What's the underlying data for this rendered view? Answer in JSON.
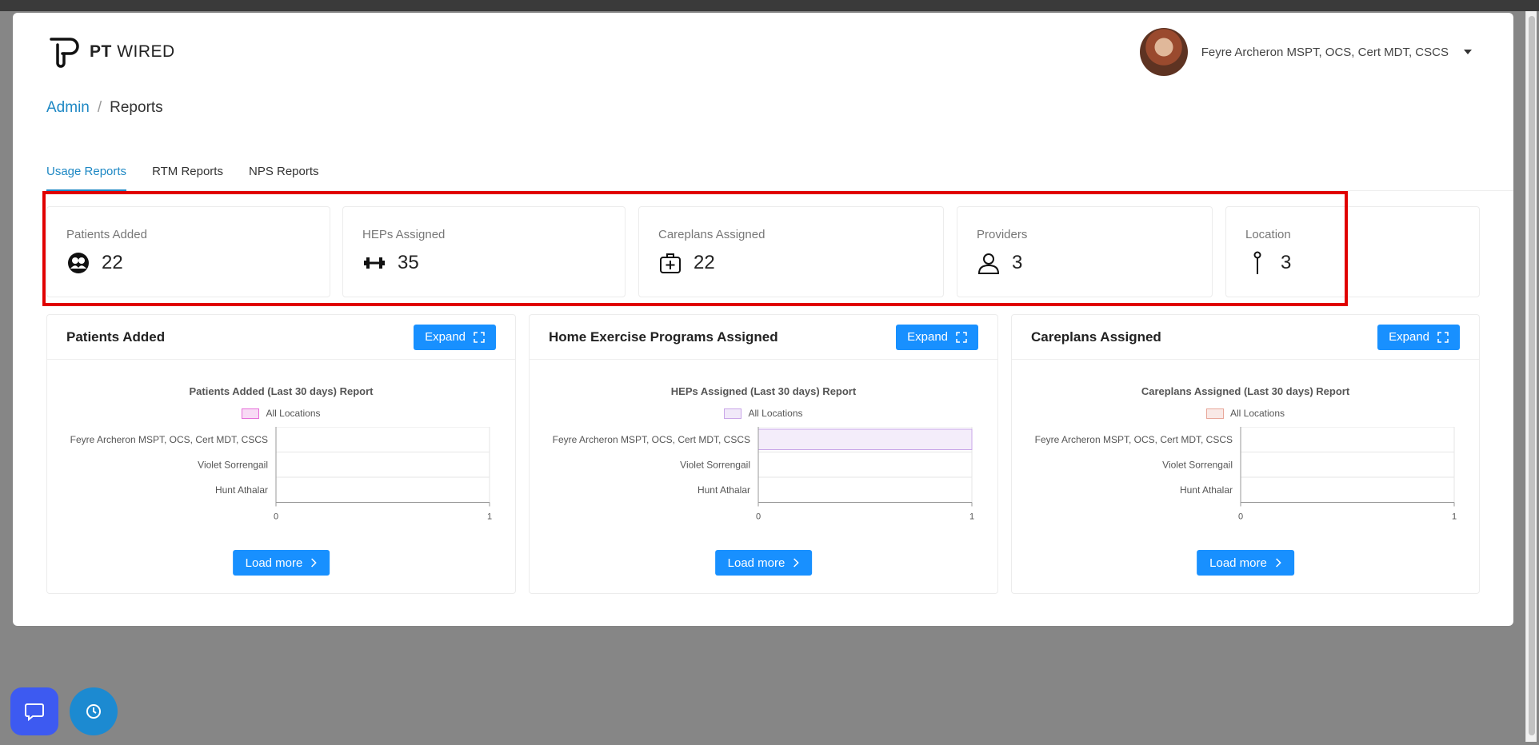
{
  "app": {
    "logo_bold": "PT",
    "logo_rest": "WIRED"
  },
  "user": {
    "name": "Feyre Archeron MSPT, OCS, Cert MDT, CSCS"
  },
  "breadcrumb": {
    "root": "Admin",
    "separator": "/",
    "current": "Reports"
  },
  "tabs": [
    {
      "label": "Usage Reports",
      "active": true
    },
    {
      "label": "RTM Reports",
      "active": false
    },
    {
      "label": "NPS Reports",
      "active": false
    }
  ],
  "stats": [
    {
      "label": "Patients Added",
      "value": "22",
      "icon": "patients-icon"
    },
    {
      "label": "HEPs Assigned",
      "value": "35",
      "icon": "dumbbell-icon"
    },
    {
      "label": "Careplans Assigned",
      "value": "22",
      "icon": "medical-kit-icon"
    },
    {
      "label": "Providers",
      "value": "3",
      "icon": "user-icon"
    },
    {
      "label": "Location",
      "value": "3",
      "icon": "pin-icon"
    }
  ],
  "panels": [
    {
      "title": "Patients Added",
      "expand_label": "Expand",
      "load_more_label": "Load more"
    },
    {
      "title": "Home Exercise Programs Assigned",
      "expand_label": "Expand",
      "load_more_label": "Load more"
    },
    {
      "title": "Careplans Assigned",
      "expand_label": "Expand",
      "load_more_label": "Load more"
    }
  ],
  "chart_data": [
    {
      "type": "bar",
      "orientation": "horizontal",
      "title": "Patients Added (Last 30 days) Report",
      "categories": [
        "Feyre Archeron MSPT, OCS, Cert MDT, CSCS",
        "Violet Sorrengail",
        "Hunt Athalar"
      ],
      "series": [
        {
          "name": "All Locations",
          "values": [
            0,
            0,
            0
          ],
          "color": "#e56fd9"
        }
      ],
      "xlim": [
        0,
        1
      ],
      "xticks": [
        "0",
        "1"
      ],
      "grid": true,
      "legend": "top"
    },
    {
      "type": "bar",
      "orientation": "horizontal",
      "title": "HEPs Assigned (Last 30 days) Report",
      "categories": [
        "Feyre Archeron MSPT, OCS, Cert MDT, CSCS",
        "Violet Sorrengail",
        "Hunt Athalar"
      ],
      "series": [
        {
          "name": "All Locations",
          "values": [
            1,
            0,
            0
          ],
          "color": "#c9a6e8"
        }
      ],
      "xlim": [
        0,
        1
      ],
      "xticks": [
        "0",
        "1"
      ],
      "grid": true,
      "legend": "top"
    },
    {
      "type": "bar",
      "orientation": "horizontal",
      "title": "Careplans Assigned (Last 30 days) Report",
      "categories": [
        "Feyre Archeron MSPT, OCS, Cert MDT, CSCS",
        "Violet Sorrengail",
        "Hunt Athalar"
      ],
      "series": [
        {
          "name": "All Locations",
          "values": [
            0,
            0,
            0
          ],
          "color": "#e8a79a"
        }
      ],
      "xlim": [
        0,
        1
      ],
      "xticks": [
        "0",
        "1"
      ],
      "grid": true,
      "legend": "top"
    }
  ]
}
